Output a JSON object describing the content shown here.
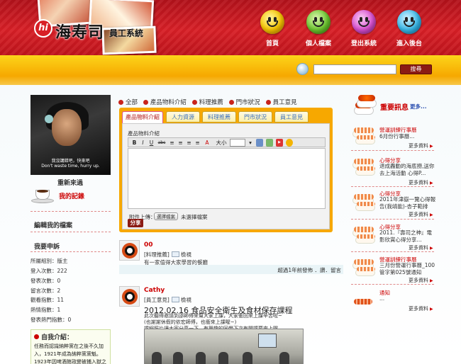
{
  "header": {
    "logo_badge": "hi",
    "logo_title": "海寿司",
    "logo_subtitle": "員工系統",
    "nav": [
      {
        "label": "首頁",
        "color": "#f5c400"
      },
      {
        "label": "個人檔案",
        "color": "#6cc630"
      },
      {
        "label": "登出系統",
        "color": "#d84fd0"
      },
      {
        "label": "進入後台",
        "color": "#39b8e8"
      }
    ]
  },
  "search": {
    "value": "",
    "button": "搜尋"
  },
  "profile": {
    "subtitle_line1": "我沒講錯吧，快來吧",
    "subtitle_line2": "Don't waste time, hurry up.",
    "refresh": "重新來過",
    "my_records": "我的記錄",
    "edit_profile": "編輯我的檔案",
    "my_news": "我要申訴",
    "stats": [
      "所屬組別：版主",
      "登入次數：222",
      "發表次數：0",
      "留言次數：2",
      "觀看指數：11",
      "熱情指數：1",
      "發表熱門指數：0"
    ],
    "intro_title": "自我介紹：",
    "intro_lines": [
      "任務而認識納粹黨在之後不久加",
      "入，1921年成為納粹黨黨魁。",
      "1923年因啤酒館政變被捕入獄之"
    ]
  },
  "categories": [
    "全部",
    "產品物料介紹",
    "料理推薦",
    "門市狀況",
    "員工意見"
  ],
  "editor": {
    "tabs": [
      "產品物料介紹",
      "人力資源",
      "料理推薦",
      "門市狀況",
      "員工意見"
    ],
    "label": "產品物料介紹",
    "toolbar": [
      "B",
      "I",
      "U",
      "abc",
      "≡",
      "≡",
      "≡",
      "≡",
      "A",
      "大小"
    ],
    "upload_label": "附件上傳：",
    "file_button": "選擇檔案",
    "no_file": "未選擇檔案",
    "share": "分享"
  },
  "posts": [
    {
      "name": "00",
      "category": "[料理推薦]",
      "view": "檢視",
      "text": "有一家值得大家學習的餐廳",
      "meta": "超過1年前發佈 ．讚．留言"
    },
    {
      "name": "Cathy",
      "category": "[員工意見]",
      "view": "檢視",
      "title": "2012.02.16 食品安全衛生及食材保存課程",
      "lines": [
        "此次聽得邀請到邵師傅來幫大家上課，大家衝回來上課辛苦啦~",
        "(也謝謝休假的依宏師傅，也衝來上課喔~)",
        "課程照片讓大家分享一下，有興趣的同學下次有開課要來上喔。"
      ]
    }
  ],
  "news": {
    "title": "重要訊息",
    "more": "更多...",
    "items": [
      {
        "title": "營運訓練行事曆",
        "sub": "6月份行事曆...",
        "more": "更多資料"
      },
      {
        "title": "心得分享",
        "sub": "退成轟動的海底撈,送你去上海活動 心得P...",
        "more": "更多資料"
      },
      {
        "title": "心得分享",
        "sub": "2011年津嶽一覽心得報告(我靖能)-杏子範排心...",
        "more": "更多資料"
      },
      {
        "title": "心得分享",
        "sub": "2011.『壽司之神』電影欣賞心得分享...",
        "more": "更多資料"
      },
      {
        "title": "營運訓練行事曆",
        "sub": "三月份營運行事曆_100管字第025號通知",
        "more": "更多資料"
      },
      {
        "title": "通知",
        "sub": "...",
        "more": "更多資料"
      }
    ]
  }
}
